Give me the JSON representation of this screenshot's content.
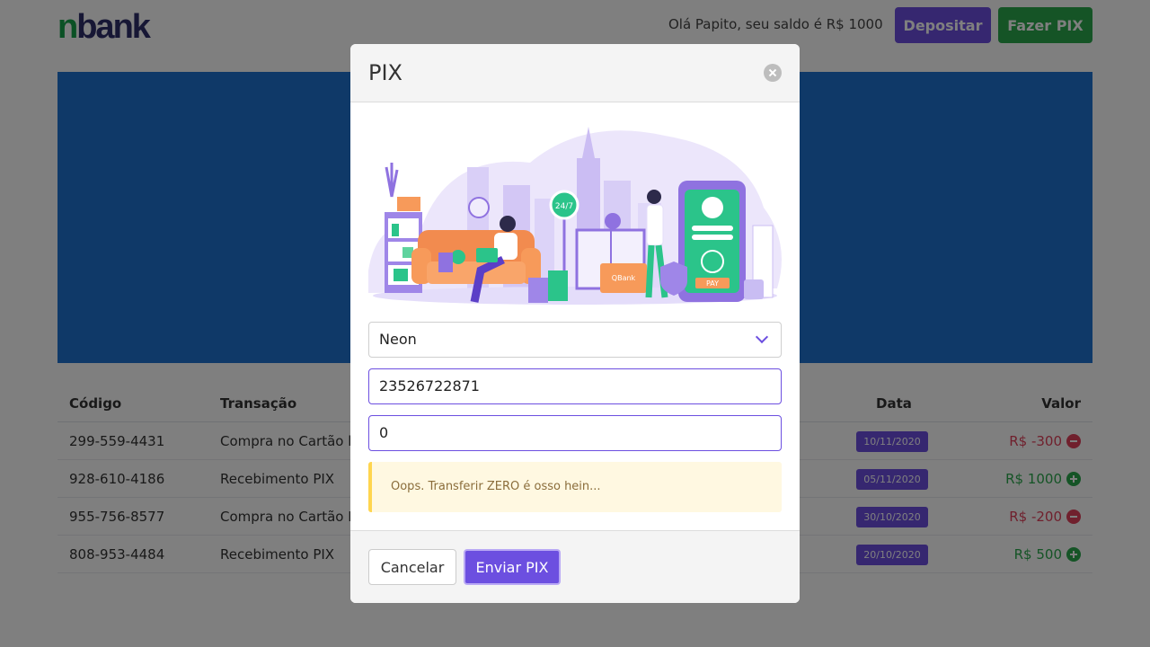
{
  "header": {
    "logo_n": "n",
    "logo_rest": "bank",
    "greeting": "Olá Papito, seu saldo é R$ 1000",
    "deposit_label": "Depositar",
    "pix_label": "Fazer PIX"
  },
  "table": {
    "headers": {
      "code": "Código",
      "transaction": "Transação",
      "date": "Data",
      "value": "Valor"
    },
    "rows": [
      {
        "code": "299-559-4431",
        "transaction": "Compra no Cartão ln",
        "date": "10/11/2020",
        "value": "R$ -300",
        "kind": "negative"
      },
      {
        "code": "928-610-4186",
        "transaction": "Recebimento PIX",
        "date": "05/11/2020",
        "value": "R$ 1000",
        "kind": "positive"
      },
      {
        "code": "955-756-8577",
        "transaction": "Compra no Cartão N",
        "date": "30/10/2020",
        "value": "R$ -200",
        "kind": "negative"
      },
      {
        "code": "808-953-4484",
        "transaction": "Recebimento PIX",
        "date": "20/10/2020",
        "value": "R$ 500",
        "kind": "positive"
      }
    ]
  },
  "modal": {
    "title": "PIX",
    "bank_select_value": "Neon",
    "pix_key_value": "23526722871",
    "amount_value": "0",
    "alert_text": "Oops. Transferir ZERO é osso hein...",
    "illustration_card_text": "QBank",
    "illustration_pay_text": "PAY",
    "illustration_247_text": "24/7",
    "cancel_label": "Cancelar",
    "send_label": "Enviar PIX"
  },
  "colors": {
    "primary": "#6c4fe0",
    "success": "#2aa84c",
    "danger": "#e0405a",
    "banner": "#1f73d0",
    "alert_bg": "#fff8e1",
    "alert_border": "#ffd54f"
  }
}
